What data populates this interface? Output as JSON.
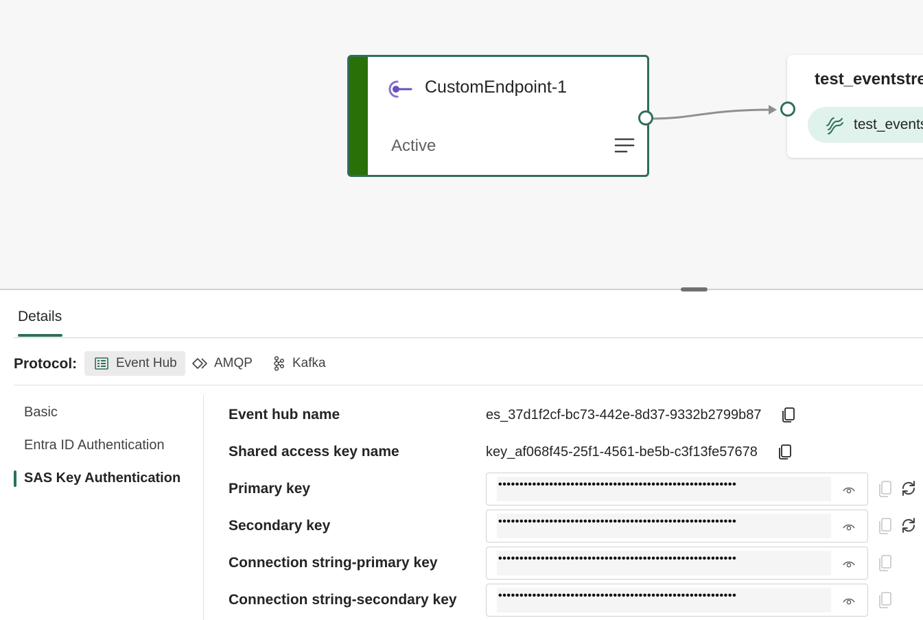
{
  "canvas": {
    "source_node": {
      "title": "CustomEndpoint-1",
      "status": "Active",
      "icon": "custom-endpoint-icon",
      "accent_color": "#2a7009",
      "border_color": "#2e6e5c"
    },
    "destination_node": {
      "title": "test_eventstream",
      "pill_label": "test_eventstream",
      "pill_icon": "eventstream-icon"
    }
  },
  "details": {
    "tab_label": "Details",
    "protocol": {
      "label": "Protocol:",
      "options": [
        {
          "label": "Event Hub",
          "icon": "event-hub-icon",
          "selected": true
        },
        {
          "label": "AMQP",
          "icon": "amqp-icon",
          "selected": false
        },
        {
          "label": "Kafka",
          "icon": "kafka-icon",
          "selected": false
        }
      ]
    },
    "nav": [
      {
        "label": "Basic",
        "selected": false
      },
      {
        "label": "Entra ID Authentication",
        "selected": false
      },
      {
        "label": "SAS Key Authentication",
        "selected": true
      }
    ],
    "fields": {
      "event_hub_name": {
        "label": "Event hub name",
        "value": "es_37d1f2cf-bc73-442e-8d37-9332b2799b87"
      },
      "shared_access_key_name": {
        "label": "Shared access key name",
        "value": "key_af068f45-25f1-4561-be5b-c3f13fe57678"
      },
      "primary_key": {
        "label": "Primary key",
        "masked": "••••••••••••••••••••••••••••••••••••••••••••••••••••••••"
      },
      "secondary_key": {
        "label": "Secondary key",
        "masked": "••••••••••••••••••••••••••••••••••••••••••••••••••••••••"
      },
      "conn_primary": {
        "label": "Connection string-primary key",
        "masked": "••••••••••••••••••••••••••••••••••••••••••••••••••••••••"
      },
      "conn_secondary": {
        "label": "Connection string-secondary key",
        "masked": "••••••••••••••••••••••••••••••••••••••••••••••••••••••••"
      }
    }
  }
}
